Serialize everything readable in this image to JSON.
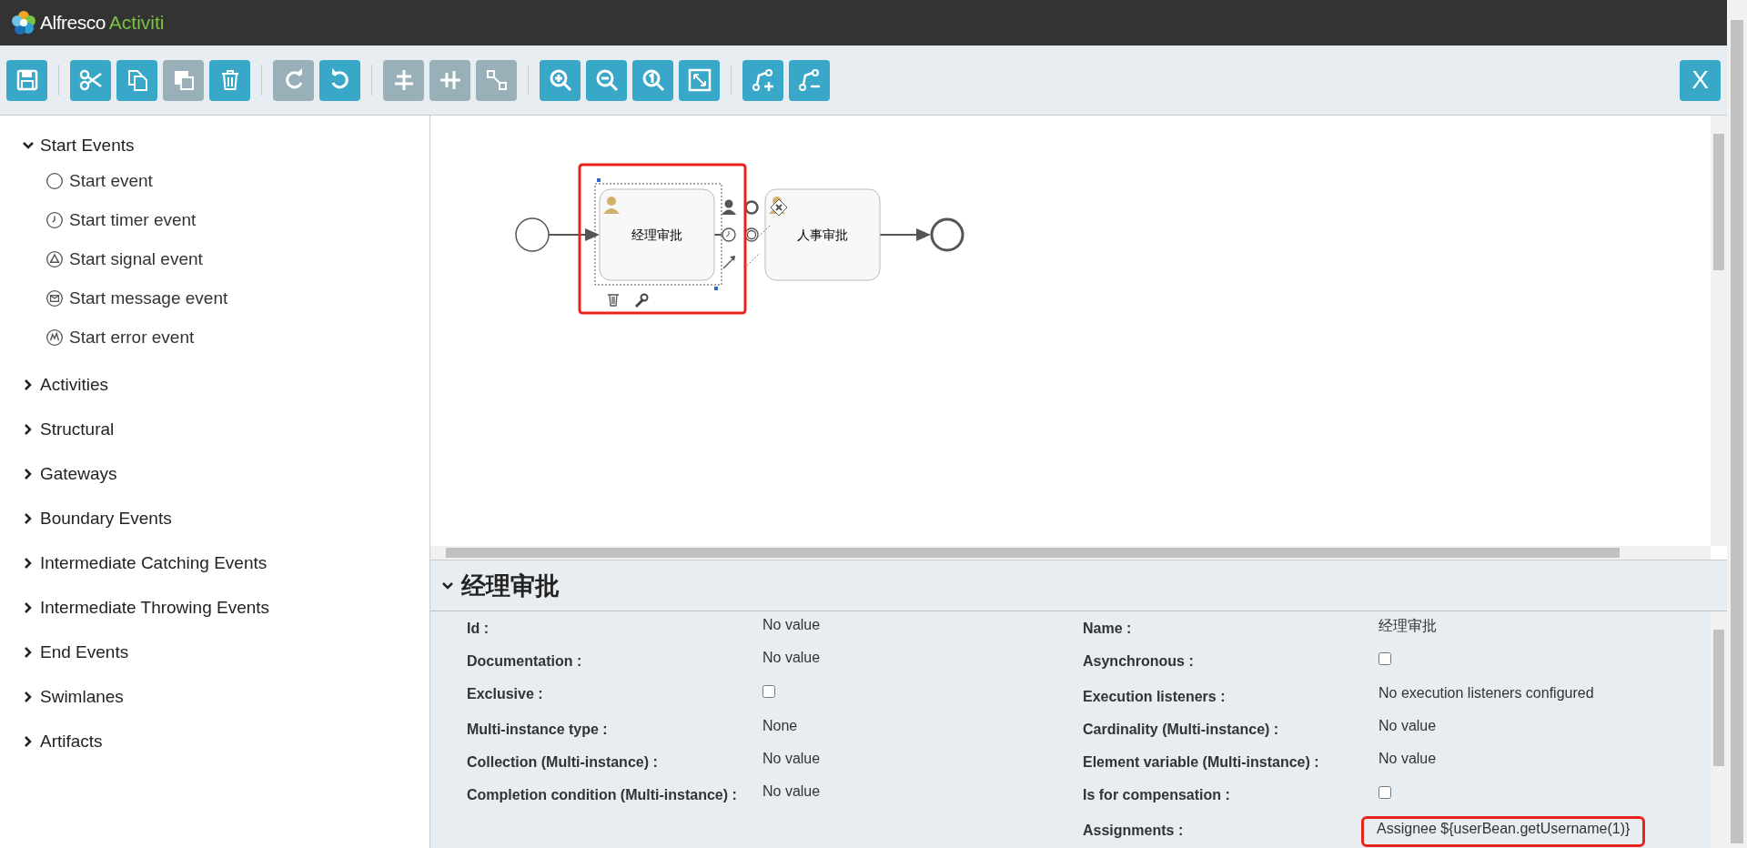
{
  "header": {
    "brand_primary": "Alfresco",
    "brand_secondary": "Activiti"
  },
  "toolbar": {
    "groups": [
      [
        {
          "kind": "save",
          "disabled": false
        }
      ],
      [
        {
          "kind": "cut",
          "disabled": false
        },
        {
          "kind": "copy",
          "disabled": false
        },
        {
          "kind": "paste",
          "disabled": true
        },
        {
          "kind": "delete",
          "disabled": false
        }
      ],
      [
        {
          "kind": "redo",
          "disabled": true
        },
        {
          "kind": "undo",
          "disabled": false
        }
      ],
      [
        {
          "kind": "align_horizontal",
          "disabled": true
        },
        {
          "kind": "align_vertical",
          "disabled": true
        },
        {
          "kind": "same_size",
          "disabled": true
        }
      ],
      [
        {
          "kind": "zoom_in",
          "disabled": false
        },
        {
          "kind": "zoom_out",
          "disabled": false
        },
        {
          "kind": "zoom_actual",
          "disabled": false
        },
        {
          "kind": "zoom_fit",
          "disabled": false
        }
      ],
      [
        {
          "kind": "add_bend",
          "disabled": false
        },
        {
          "kind": "remove_bend",
          "disabled": false
        }
      ]
    ],
    "close_button": "X"
  },
  "palette": [
    {
      "label": "Start Events",
      "expanded": true,
      "children": [
        {
          "label": "Start event",
          "kind": "none"
        },
        {
          "label": "Start timer event",
          "kind": "timer"
        },
        {
          "label": "Start signal event",
          "kind": "signal"
        },
        {
          "label": "Start message event",
          "kind": "message"
        },
        {
          "label": "Start error event",
          "kind": "error"
        }
      ]
    },
    {
      "label": "Activities",
      "expanded": false
    },
    {
      "label": "Structural",
      "expanded": false
    },
    {
      "label": "Gateways",
      "expanded": false
    },
    {
      "label": "Boundary Events",
      "expanded": false
    },
    {
      "label": "Intermediate Catching Events",
      "expanded": false
    },
    {
      "label": "Intermediate Throwing Events",
      "expanded": false
    },
    {
      "label": "End Events",
      "expanded": false
    },
    {
      "label": "Swimlanes",
      "expanded": false
    },
    {
      "label": "Artifacts",
      "expanded": false
    }
  ],
  "diagram": {
    "nodes": [
      {
        "kind": "start_event"
      },
      {
        "kind": "user_task",
        "label": "经理审批",
        "selected": true,
        "annotated": true
      },
      {
        "kind": "user_task",
        "label": "人事审批",
        "selected": false,
        "annotated": false
      },
      {
        "kind": "end_event"
      }
    ]
  },
  "properties": {
    "title": "经理审批",
    "expanded": true,
    "left": [
      {
        "label": "Id :",
        "kind": "text",
        "value": "No value"
      },
      {
        "label": "Documentation :",
        "kind": "text",
        "value": "No value"
      },
      {
        "label": "Exclusive :",
        "kind": "checkbox",
        "checked": false
      },
      {
        "label": "Multi-instance type :",
        "kind": "text",
        "value": "None"
      },
      {
        "label": "Collection (Multi-instance) :",
        "kind": "text",
        "value": "No value"
      },
      {
        "label": "Completion condition (Multi-instance) :",
        "kind": "text",
        "value": "No value"
      }
    ],
    "right": [
      {
        "label": "Name :",
        "kind": "text",
        "value": "经理审批"
      },
      {
        "label": "Asynchronous :",
        "kind": "checkbox",
        "checked": false
      },
      {
        "label": "Execution listeners :",
        "kind": "text",
        "value": "No execution listeners configured"
      },
      {
        "label": "Cardinality (Multi-instance) :",
        "kind": "text",
        "value": "No value"
      },
      {
        "label": "Element variable (Multi-instance) :",
        "kind": "text",
        "value": "No value"
      },
      {
        "label": "Is for compensation :",
        "kind": "checkbox",
        "checked": false
      },
      {
        "label": "Assignments :",
        "kind": "text",
        "value": "Assignee ${userBean.getUsername(1)}",
        "annotated": true
      }
    ]
  }
}
